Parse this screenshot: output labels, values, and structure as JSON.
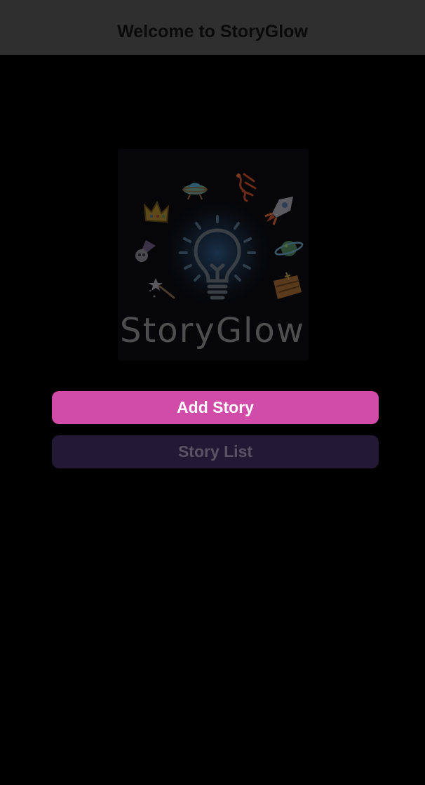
{
  "header": {
    "title": "Welcome to StoryGlow"
  },
  "logo": {
    "wordmark": "StoryGlow",
    "icons": [
      "ufo-icon",
      "dragon-icon",
      "crown-icon",
      "rocket-icon",
      "wizard-hat-icon",
      "planet-icon",
      "magic-wand-icon",
      "treasure-map-icon",
      "lightbulb-icon"
    ]
  },
  "actions": {
    "add_story_label": "Add Story",
    "story_list_label": "Story List"
  },
  "colors": {
    "primary_button": "#d14ba8",
    "secondary_button": "#221a34",
    "header_background": "#2f2f2f",
    "page_background": "#000000"
  }
}
